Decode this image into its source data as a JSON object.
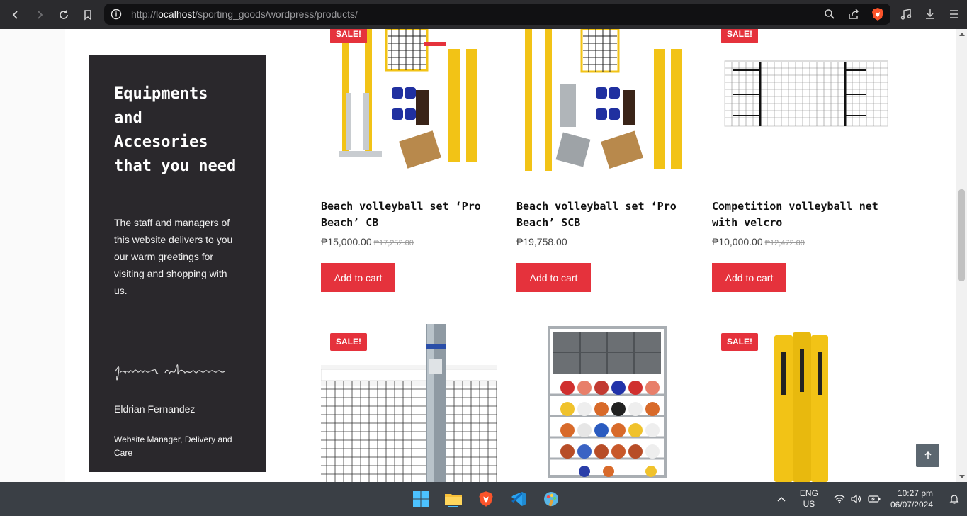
{
  "browser": {
    "url_prefix": "http://",
    "url_host": "localhost",
    "url_path": "/sporting_goods/wordpress/products/"
  },
  "profile": {
    "heading": "Equipments and Accesories that you need",
    "text": "The staff and managers of this website delivers to you our warm greetings for visiting and shopping with us.",
    "signature": "fernandez eldrian",
    "name": "Eldrian Fernandez",
    "role": "Website Manager, Delivery and Care"
  },
  "products": [
    {
      "title": "Beach volleyball set ‘Pro Beach’ CB",
      "price": "₱15,000.00",
      "old_price": "₱17,252.00",
      "button": "Add to cart"
    },
    {
      "title": "Beach volleyball set ‘Pro Beach’ SCB",
      "price": "₱19,758.00",
      "old_price": "",
      "button": "Add to cart"
    },
    {
      "title": "Competition volleyball net with velcro",
      "price": "₱10,000.00",
      "old_price": "₱12,472.00",
      "button": "Add to cart"
    }
  ],
  "badges": {
    "sale": "SALE!"
  },
  "taskbar": {
    "lang1": "ENG",
    "lang2": "US",
    "time": "10:27 pm",
    "date": "06/07/2024"
  },
  "colors": {
    "accent": "#e5323c",
    "card": "#2a282c",
    "chrome": "#2b2b2e"
  }
}
